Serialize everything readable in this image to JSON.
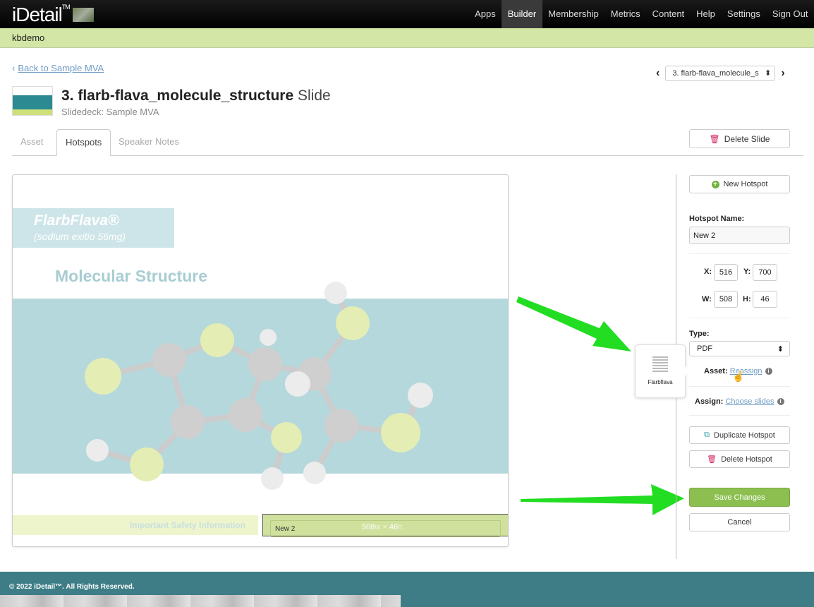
{
  "header": {
    "logo": "iDetail",
    "logo_tm": "TM",
    "nav": [
      "Apps",
      "Builder",
      "Membership",
      "Metrics",
      "Content",
      "Help",
      "Settings",
      "Sign Out"
    ],
    "active_nav": "Builder"
  },
  "user": "kbdemo",
  "back_link": "Back to Sample MVA",
  "slide": {
    "number": "3.",
    "name": "flarb-flava_molecule_structure",
    "suffix": "Slide",
    "deck": "Slidedeck: Sample MVA"
  },
  "slide_selector": "3. flarb-flava_molecule_s",
  "tabs": [
    "Asset",
    "Hotspots",
    "Speaker Notes"
  ],
  "delete_slide": "Delete Slide",
  "canvas": {
    "brand": "FlarbFlava®",
    "brand_sub": "(sodium exitio 56mg)",
    "heading": "Molecular Structure",
    "isi": "Important Safety Information",
    "hotspot_label": "New 2",
    "hotspot_w": "508",
    "hotspot_h": "46",
    "w_unit": "w",
    "times": "×",
    "h_unit": "h"
  },
  "panel": {
    "new_hotspot": "New Hotspot",
    "name_label": "Hotspot Name:",
    "name_value": "New 2",
    "x_label": "X:",
    "x": "516",
    "y_label": "Y:",
    "y": "700",
    "w_label": "W:",
    "w": "508",
    "h_label": "H:",
    "h": "46",
    "type_label": "Type:",
    "type_value": "PDF",
    "asset_label": "Asset:",
    "reassign": "Reassign",
    "assign_label": "Assign:",
    "choose_slides": "Choose slides",
    "duplicate": "Duplicate Hotspot",
    "delete_hotspot": "Delete Hotspot",
    "save": "Save Changes",
    "cancel": "Cancel"
  },
  "asset_popover": {
    "name": "Flarbflava"
  },
  "footer": "© 2022 iDetail™.  All Rights Reserved.",
  "colors": {
    "accent_green": "#8cbf50",
    "arrow_green": "#22dd22",
    "user_bar": "#d3e6a6",
    "footer": "#3e7d86",
    "slide_teal": "#b5d8dc"
  }
}
